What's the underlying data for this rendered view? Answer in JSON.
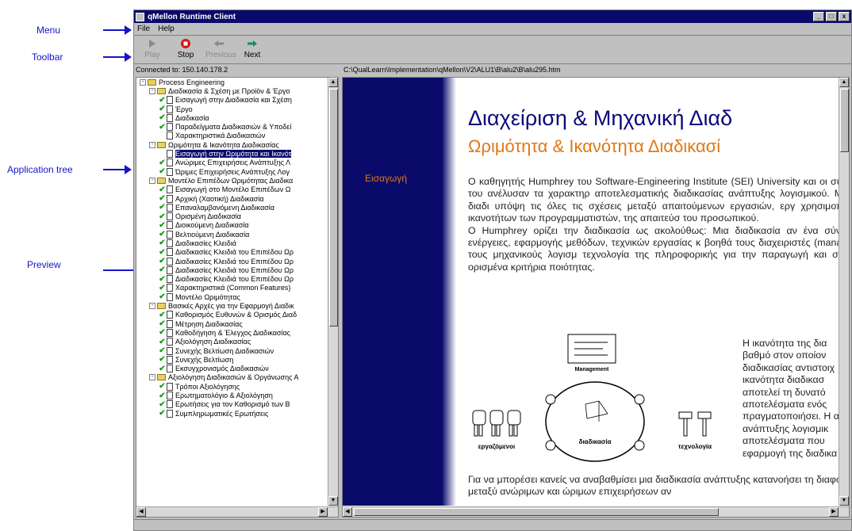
{
  "annotations": {
    "menu": "Menu",
    "toolbar": "Toolbar",
    "application_tree": "Application tree",
    "preview": "Preview"
  },
  "window": {
    "title": "qMellon Runtime Client",
    "controls": {
      "minimize": "_",
      "maximize": "□",
      "close": "x"
    }
  },
  "menu": {
    "file": "File",
    "help": "Help"
  },
  "toolbar": {
    "play": {
      "label": "Play",
      "icon": "play-icon",
      "disabled": true
    },
    "stop": {
      "label": "Stop",
      "icon": "stop-icon",
      "disabled": false
    },
    "previous": {
      "label": "Previous",
      "icon": "back-arrow-icon",
      "disabled": true
    },
    "next": {
      "label": "Next",
      "icon": "forward-arrow-icon",
      "disabled": false
    }
  },
  "status": {
    "connection": "Connected to: 150.140.178.2",
    "path": "C:\\QualLearn\\Implementation\\qMellon\\V2\\ALU1\\B\\alu2\\B\\alu295.htm"
  },
  "tree": {
    "items": [
      {
        "indent": 0,
        "expander": "-",
        "icon": "folder",
        "label": "Process Engineering"
      },
      {
        "indent": 1,
        "expander": "-",
        "icon": "folder",
        "label": "Διαδικασία & Σχέση με Προϊόν & Έργο"
      },
      {
        "indent": 2,
        "check": true,
        "icon": "doc",
        "label": "Εισαγωγή στην Διαδικασία και Σχέση"
      },
      {
        "indent": 2,
        "check": true,
        "icon": "doc",
        "label": "Έργο"
      },
      {
        "indent": 2,
        "check": true,
        "icon": "doc",
        "label": "Διαδικασία"
      },
      {
        "indent": 2,
        "check": true,
        "icon": "doc",
        "label": "Παραδείγματα Διαδικασιών & Υποδεί"
      },
      {
        "indent": 2,
        "check": false,
        "icon": "doc",
        "label": "Χαρακτηριστικά Διαδικασιών"
      },
      {
        "indent": 1,
        "expander": "-",
        "icon": "folder",
        "label": "Ωριμότητα & Ικανότητα Διαδικασίας"
      },
      {
        "indent": 2,
        "check": false,
        "icon": "doc",
        "label": "Εισαγωγή στην Ωριμότητα και Ικανότ",
        "selected": true
      },
      {
        "indent": 2,
        "check": true,
        "icon": "doc",
        "label": "Ανώριμες Επιχειρήσεις Ανάπτυξης Λ"
      },
      {
        "indent": 2,
        "check": true,
        "icon": "doc",
        "label": "Ώριμες Επιχειρήσεις Ανάπτυξης Λογ"
      },
      {
        "indent": 1,
        "expander": "-",
        "icon": "folder",
        "label": "Μοντέλο Επιπέδων Ωριμότητας Διαδικα"
      },
      {
        "indent": 2,
        "check": true,
        "icon": "doc",
        "label": "Εισαγωγή στο Μοντέλο Επιπέδων Ω"
      },
      {
        "indent": 2,
        "check": true,
        "icon": "doc",
        "label": "Αρχική (Χαοτική) Διαδικασία"
      },
      {
        "indent": 2,
        "check": true,
        "icon": "doc",
        "label": "Επαναλαμβανόμενη Διαδικασία"
      },
      {
        "indent": 2,
        "check": true,
        "icon": "doc",
        "label": "Ορισμένη Διαδικασία"
      },
      {
        "indent": 2,
        "check": true,
        "icon": "doc",
        "label": "Διοικούμενη Διαδικασία"
      },
      {
        "indent": 2,
        "check": true,
        "icon": "doc",
        "label": "Βελτιούμενη Διαδικασία"
      },
      {
        "indent": 2,
        "check": true,
        "icon": "doc",
        "label": "Διαδικασίες Κλειδιά"
      },
      {
        "indent": 2,
        "check": true,
        "icon": "doc",
        "label": "Διαδικασίες Κλειδιά του Επιπέδου Ωρ"
      },
      {
        "indent": 2,
        "check": true,
        "icon": "doc",
        "label": "Διαδικασίες Κλειδιά του Επιπέδου Ωρ"
      },
      {
        "indent": 2,
        "check": true,
        "icon": "doc",
        "label": "Διαδικασίες Κλειδιά του Επιπέδου Ωρ"
      },
      {
        "indent": 2,
        "check": true,
        "icon": "doc",
        "label": "Διαδικασίες Κλειδιά του Επιπέδου Ωρ"
      },
      {
        "indent": 2,
        "check": true,
        "icon": "doc",
        "label": "Χαρακτηριστικά (Common Features)"
      },
      {
        "indent": 2,
        "check": true,
        "icon": "doc",
        "label": "Μοντέλο Ωριμότητας"
      },
      {
        "indent": 1,
        "expander": "-",
        "icon": "folder",
        "label": "Βασικές Αρχές για την Εφαρμογή Διαδικ"
      },
      {
        "indent": 2,
        "check": true,
        "icon": "doc",
        "label": "Καθορισμός Ευθυνών & Ορισμός Διαδ"
      },
      {
        "indent": 2,
        "check": true,
        "icon": "doc",
        "label": "Μέτρηση Διαδικασίας"
      },
      {
        "indent": 2,
        "check": true,
        "icon": "doc",
        "label": "Καθοδήγηση & Έλεγχος Διαδικασίας"
      },
      {
        "indent": 2,
        "check": true,
        "icon": "doc",
        "label": "Αξιολόγηση Διαδικασίας"
      },
      {
        "indent": 2,
        "check": true,
        "icon": "doc",
        "label": "Συνεχής Βελτίωση Διαδικασιών"
      },
      {
        "indent": 2,
        "check": true,
        "icon": "doc",
        "label": "Συνεχής Βελτίωση"
      },
      {
        "indent": 2,
        "check": true,
        "icon": "doc",
        "label": "Εκσυγχρονισμός Διαδικασιών"
      },
      {
        "indent": 1,
        "expander": "-",
        "icon": "folder",
        "label": "Αξιολόγηση Διαδικασιών & Οργάνωσης Α"
      },
      {
        "indent": 2,
        "check": true,
        "icon": "doc",
        "label": "Τρόποι Αξιολόγησης"
      },
      {
        "indent": 2,
        "check": true,
        "icon": "doc",
        "label": "Ερωτηματολόγιο & Αξιολόγηση"
      },
      {
        "indent": 2,
        "check": true,
        "icon": "doc",
        "label": "Ερωτήσεις για τον Καθορισμό των Β"
      },
      {
        "indent": 2,
        "check": true,
        "icon": "doc",
        "label": "Συμπληρωματικές Ερωτήσεις"
      }
    ]
  },
  "preview": {
    "nav_item": "Εισαγωγή",
    "heading1": "Διαχείριση & Μηχανική Διαδ",
    "heading2": "Ωριμότητα & Ικανότητα Διαδικασί",
    "paragraph": "Ο καθηγητής Humphrey του Software-Engineering Institute (SEI) University και οι συνεργάτες του ανέλυσαν τα χαρακτηρ αποτελεσματικής διαδικασίας ανάπτυξης λογισμικού. Μια τέτοια διαδι υπόψη τις όλες τις σχέσεις μεταξύ απαιτούμενων εργασιών, εργ χρησιμοποιούνται, ικανοτήτων των προγραμματιστών, της απαιτεύσ του προσωπικού.\nΟ Humphrey ορίζει την διαδικασία ως ακολούθως: Μια διαδικασία αν ένα σύνολο από ενέργειες, εφαρμογής μεθόδων, τεχνικών εργασίας κ βοηθά τους διαχειριστές (managers) και τους μηχανικούς λογισμ τεχνολογία της πληροφορικής για την παραγωγή και συντήρηση ορισμένα κριτήρια ποιότητας.",
    "side_text": "Η ικανότητα της δια βαθμό στον οποίον διαδικασίας αντιστοιχ ικανότητα διαδικασ αποτελεί τη δυνατό αποτελέσματα ενός πραγματοποιήσει. Η α ανάπτυξης λογισμικ αποτελέσματα που εφαρμογή της διαδικα",
    "bottom_text": "Για να μπορέσει κανείς να αναβαθμίσει μια διαδικασία ανάπτυξης κατανοήσει τη διαφορά μεταξύ ανώριμων και ώριμων επιχειρήσεων αν",
    "diagram": {
      "management": "Management",
      "workers": "εργαζόμενοι",
      "process": "διαδικασία",
      "technology": "τεχνολογία"
    }
  }
}
